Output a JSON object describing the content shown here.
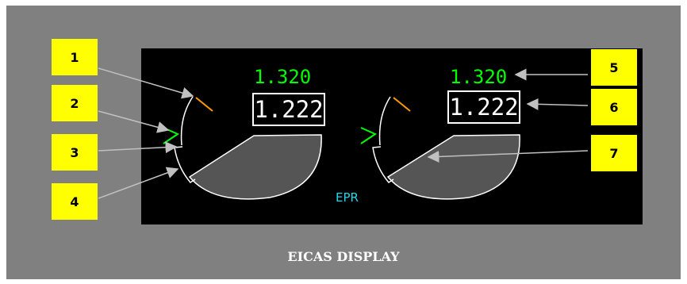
{
  "caption": "EICAS DISPLAY",
  "callouts": [
    {
      "id": "1",
      "label": "1"
    },
    {
      "id": "2",
      "label": "2"
    },
    {
      "id": "3",
      "label": "3"
    },
    {
      "id": "4",
      "label": "4"
    },
    {
      "id": "5",
      "label": "5"
    },
    {
      "id": "6",
      "label": "6"
    },
    {
      "id": "7",
      "label": "7"
    }
  ],
  "engines": [
    {
      "commanded": "1.320",
      "actual": "1.222"
    },
    {
      "commanded": "1.320",
      "actual": "1.222"
    }
  ],
  "gauge_label": "EPR",
  "colors": {
    "panel": "#808080",
    "screen": "#000000",
    "callout": "#ffff00",
    "commanded": "#00ff00",
    "actual": "#ffffff",
    "limit_marker": "#ff9900",
    "epr_label": "#22d6e6",
    "pointer_fill": "#555555"
  }
}
